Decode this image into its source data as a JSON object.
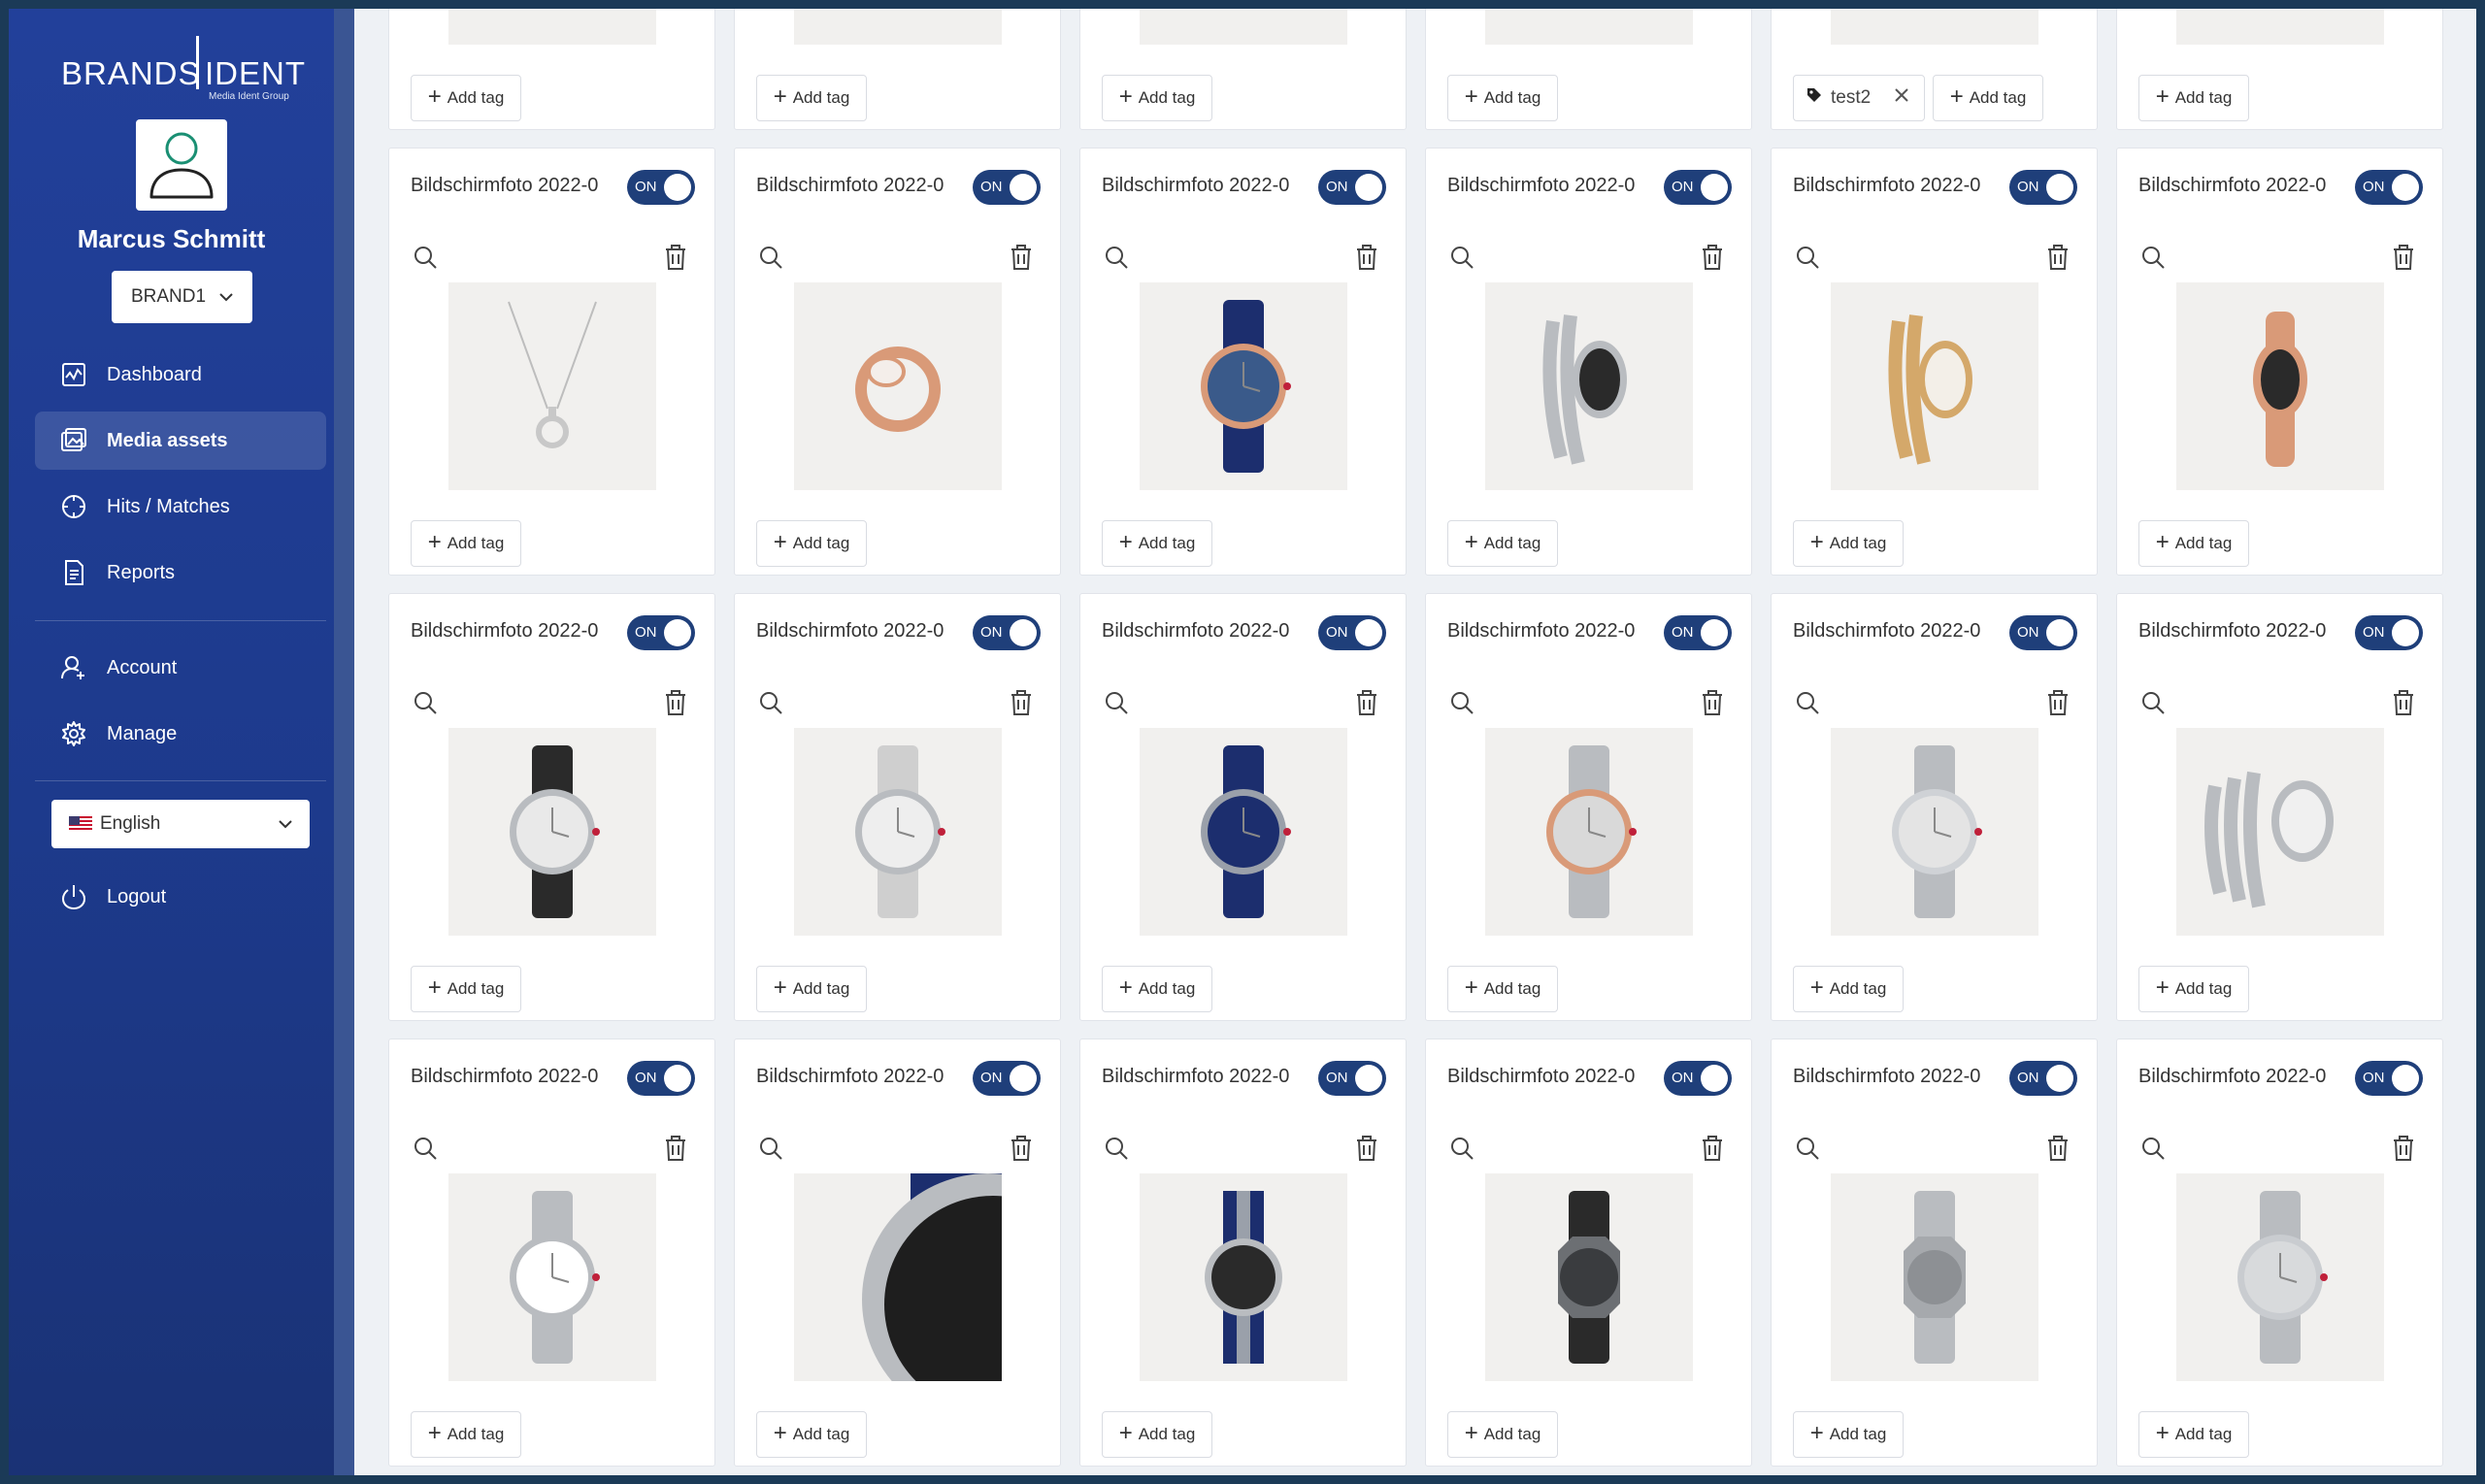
{
  "app": {
    "logo_left": "BRANDS",
    "logo_right": "IDENT",
    "logo_sub": "Media Ident Group"
  },
  "user": {
    "name": "Marcus Schmitt",
    "brand": "BRAND1"
  },
  "nav": {
    "dashboard": "Dashboard",
    "media_assets": "Media assets",
    "hits_matches": "Hits / Matches",
    "reports": "Reports",
    "account": "Account",
    "manage": "Manage",
    "language": "English",
    "logout": "Logout"
  },
  "colors": {
    "sidebar": "#1f3d91",
    "toggle_on": "#1f3f7a",
    "background": "#eef1f5"
  },
  "common": {
    "add_tag": "Add tag",
    "toggle_on": "ON",
    "existing_tag": "test2"
  },
  "cards_top": [
    {
      "tags": []
    },
    {
      "tags": []
    },
    {
      "tags": []
    },
    {
      "tags": []
    },
    {
      "tags": [
        "test2"
      ]
    },
    {
      "tags": []
    }
  ],
  "cards": [
    {
      "title": "Bildschirmfoto 2022-0",
      "on": true,
      "image": "necklace"
    },
    {
      "title": "Bildschirmfoto 2022-0",
      "on": true,
      "image": "ring"
    },
    {
      "title": "Bildschirmfoto 2022-0",
      "on": true,
      "image": "watch-blue-skeleton"
    },
    {
      "title": "Bildschirmfoto 2022-0",
      "on": true,
      "image": "serpenti-silver"
    },
    {
      "title": "Bildschirmfoto 2022-0",
      "on": true,
      "image": "serpenti-gold"
    },
    {
      "title": "Bildschirmfoto 2022-0",
      "on": true,
      "image": "serpenti-rosegold"
    },
    {
      "title": "Bildschirmfoto 2022-0",
      "on": true,
      "image": "watch-black-strap"
    },
    {
      "title": "Bildschirmfoto 2022-0",
      "on": true,
      "image": "watch-grey-strap"
    },
    {
      "title": "Bildschirmfoto 2022-0",
      "on": true,
      "image": "watch-navy"
    },
    {
      "title": "Bildschirmfoto 2022-0",
      "on": true,
      "image": "watch-bracelet-rosegold"
    },
    {
      "title": "Bildschirmfoto 2022-0",
      "on": true,
      "image": "watch-bracelet-silver"
    },
    {
      "title": "Bildschirmfoto 2022-0",
      "on": true,
      "image": "serpenti-double"
    },
    {
      "title": "Bildschirmfoto 2022-0",
      "on": true,
      "image": "watch-white-bracelet"
    },
    {
      "title": "Bildschirmfoto 2022-0",
      "on": true,
      "image": "watch-closeup"
    },
    {
      "title": "Bildschirmfoto 2022-0",
      "on": true,
      "image": "watch-nato-strap"
    },
    {
      "title": "Bildschirmfoto 2022-0",
      "on": true,
      "image": "octo-chrono"
    },
    {
      "title": "Bildschirmfoto 2022-0",
      "on": true,
      "image": "octo-steel"
    },
    {
      "title": "Bildschirmfoto 2022-0",
      "on": true,
      "image": "watch-steel-bracelet"
    }
  ]
}
